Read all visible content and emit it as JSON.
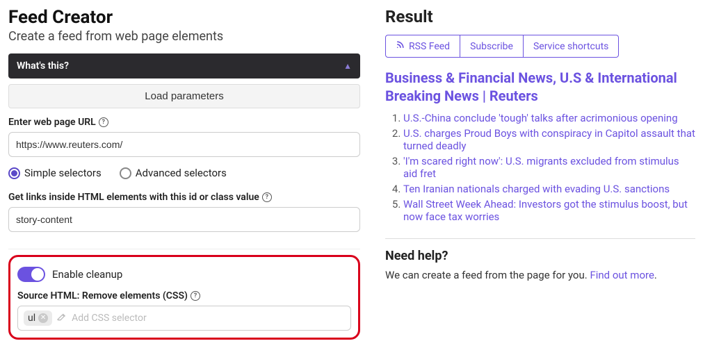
{
  "left": {
    "title": "Feed Creator",
    "subtitle": "Create a feed from web page elements",
    "accordion_label": "What's this?",
    "load_params_label": "Load parameters",
    "url_label": "Enter web page URL",
    "url_value": "https://www.reuters.com/",
    "selector_mode": {
      "simple": "Simple selectors",
      "advanced": "Advanced selectors"
    },
    "links_label": "Get links inside HTML elements with this id or class value",
    "links_value": "story-content",
    "cleanup": {
      "toggle_label": "Enable cleanup",
      "remove_label": "Source HTML: Remove elements (CSS)",
      "chip": "ul",
      "placeholder": "Add CSS selector"
    }
  },
  "right": {
    "title": "Result",
    "buttons": {
      "rss": "RSS Feed",
      "subscribe": "Subscribe",
      "shortcuts": "Service shortcuts"
    },
    "feed_title": "Business & Financial News, U.S & International Breaking News | Reuters",
    "items": [
      "U.S.-China conclude 'tough' talks after acrimonious opening",
      "U.S. charges Proud Boys with conspiracy in Capitol assault that turned deadly",
      "'I'm scared right now': U.S. migrants excluded from stimulus aid fret",
      "Ten Iranian nationals charged with evading U.S. sanctions",
      "Wall Street Week Ahead: Investors got the stimulus boost, but now face tax worries"
    ],
    "help": {
      "title": "Need help?",
      "text": "We can create a feed from the page for you. ",
      "link": "Find out more"
    }
  }
}
